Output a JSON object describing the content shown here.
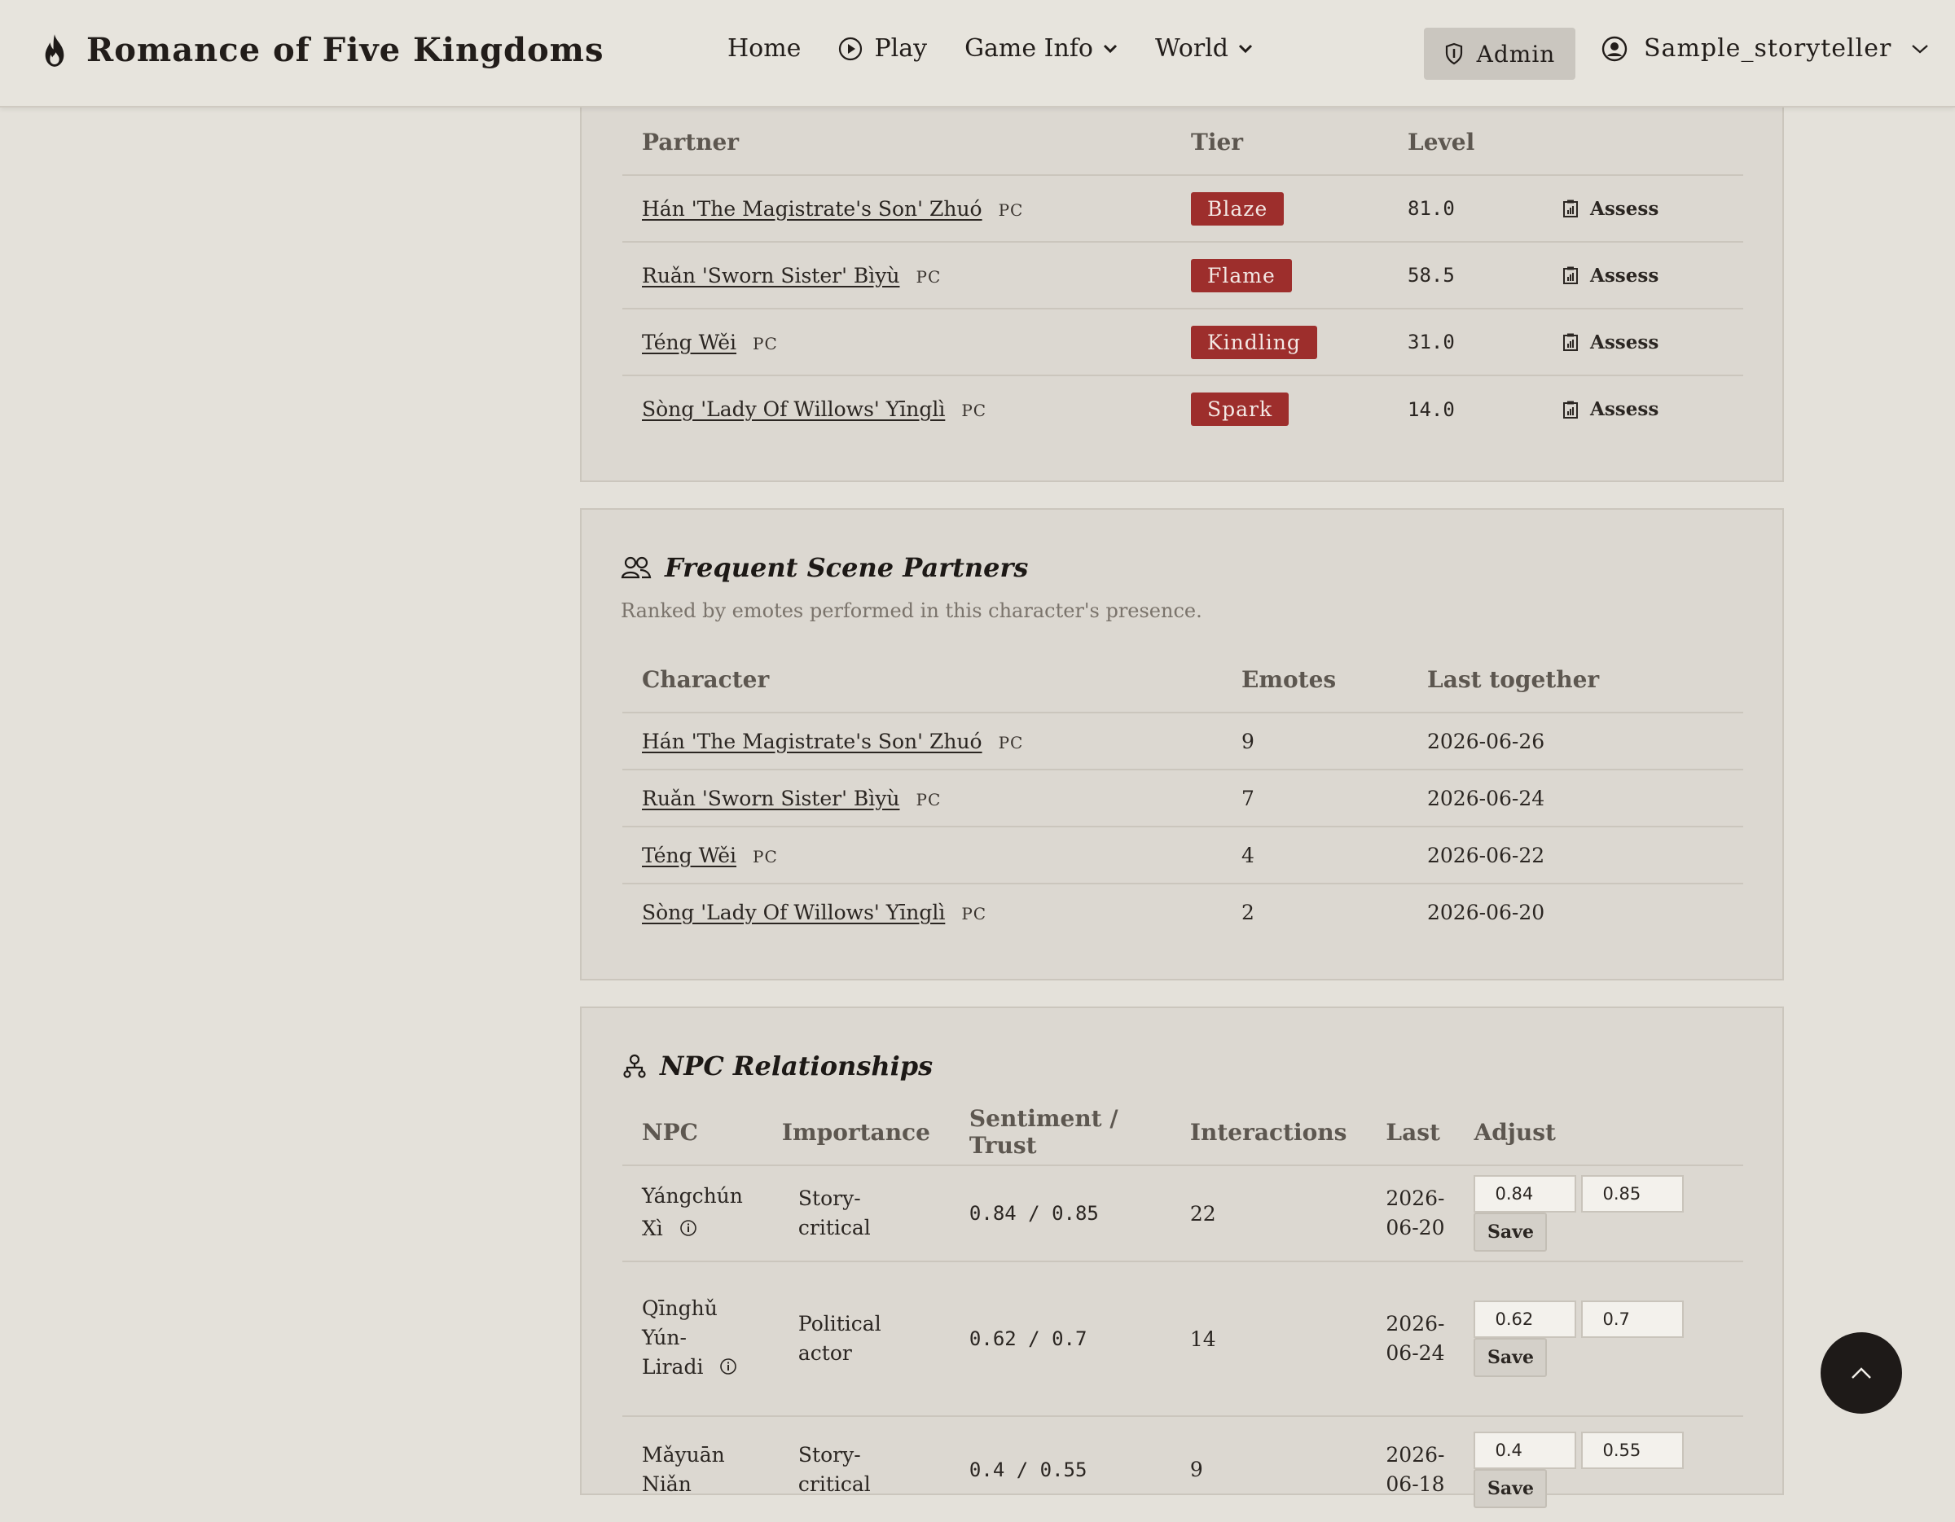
{
  "header": {
    "brand": "Romance of Five Kingdoms",
    "nav": {
      "home": "Home",
      "play": "Play",
      "game_info": "Game Info",
      "world": "World"
    },
    "admin": "Admin",
    "user": "Sample_storyteller"
  },
  "partners_table": {
    "headers": {
      "partner": "Partner",
      "tier": "Tier",
      "level": "Level"
    },
    "rows": [
      {
        "name": "Hán 'The Magistrate's Son' Zhuó",
        "tag": "PC",
        "tier": "Blaze",
        "level": "81.0",
        "action": "Assess"
      },
      {
        "name": "Ruǎn 'Sworn Sister' Bìyù",
        "tag": "PC",
        "tier": "Flame",
        "level": "58.5",
        "action": "Assess"
      },
      {
        "name": "Téng Wěi",
        "tag": "PC",
        "tier": "Kindling",
        "level": "31.0",
        "action": "Assess"
      },
      {
        "name": "Sòng 'Lady Of Willows' Yīnglì",
        "tag": "PC",
        "tier": "Spark",
        "level": "14.0",
        "action": "Assess"
      }
    ]
  },
  "frequent": {
    "title": "Frequent Scene Partners",
    "subtitle": "Ranked by emotes performed in this character's presence.",
    "headers": {
      "character": "Character",
      "emotes": "Emotes",
      "last": "Last together"
    },
    "rows": [
      {
        "name": "Hán 'The Magistrate's Son' Zhuó",
        "tag": "PC",
        "emotes": "9",
        "last": "2026-06-26"
      },
      {
        "name": "Ruǎn 'Sworn Sister' Bìyù",
        "tag": "PC",
        "emotes": "7",
        "last": "2026-06-24"
      },
      {
        "name": "Téng Wěi",
        "tag": "PC",
        "emotes": "4",
        "last": "2026-06-22"
      },
      {
        "name": "Sòng 'Lady Of Willows' Yīnglì",
        "tag": "PC",
        "emotes": "2",
        "last": "2026-06-20"
      }
    ]
  },
  "npc": {
    "title": "NPC Relationships",
    "headers": {
      "npc": "NPC",
      "importance": "Importance",
      "sentiment": "Sentiment / Trust",
      "interactions": "Interactions",
      "last": "Last",
      "adjust": "Adjust"
    },
    "rows": [
      {
        "name": "Yángchún Xì",
        "importance": "Story-critical",
        "sentiment": "0.84 / 0.85",
        "interactions": "22",
        "last": "2026-06-20",
        "s_val": "0.84",
        "t_val": "0.85",
        "save": "Save"
      },
      {
        "name": "Qīnghǔ Yún-Liradi",
        "importance": "Political actor",
        "sentiment": "0.62 / 0.7",
        "interactions": "14",
        "last": "2026-06-24",
        "s_val": "0.62",
        "t_val": "0.7",
        "save": "Save"
      },
      {
        "name": "Mǎyuān Niǎn",
        "importance": "Story-critical",
        "sentiment": "0.4 / 0.55",
        "interactions": "9",
        "last": "2026-06-18",
        "s_val": "0.4",
        "t_val": "0.55",
        "save": "Save"
      }
    ]
  }
}
